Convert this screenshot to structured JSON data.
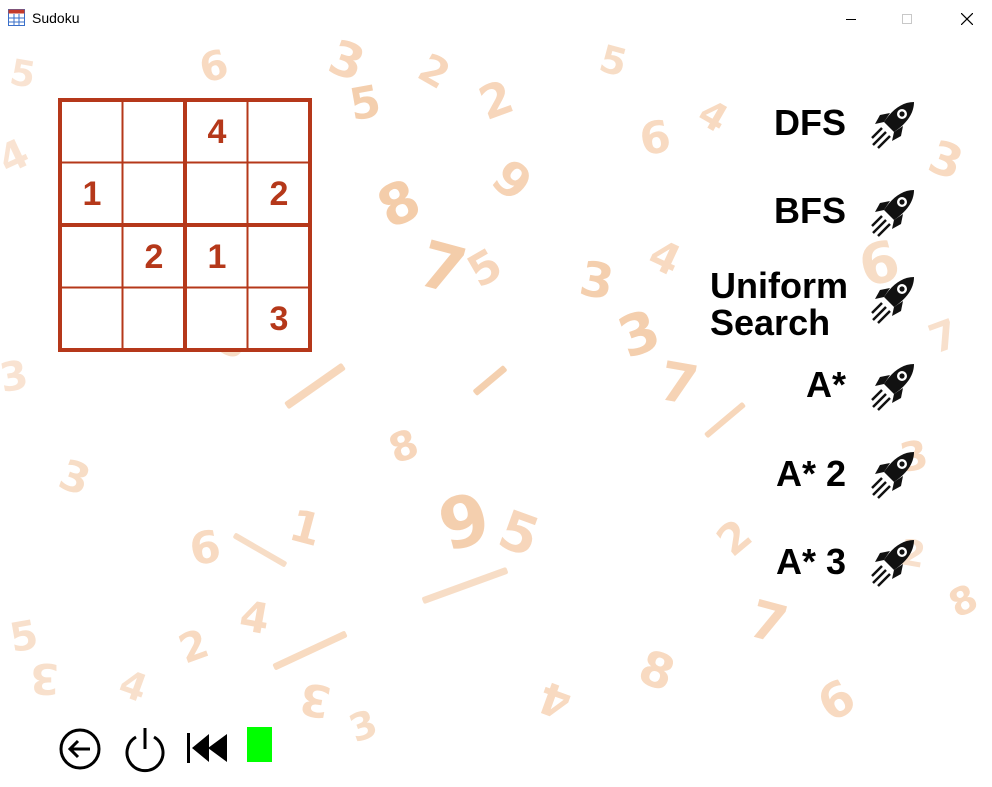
{
  "window": {
    "title": "Sudoku",
    "accent": "#b5381a"
  },
  "board": {
    "size": 4,
    "cells": [
      [
        "",
        "",
        "4",
        ""
      ],
      [
        "1",
        "",
        "",
        "2"
      ],
      [
        "",
        "2",
        "1",
        ""
      ],
      [
        "",
        "",
        "",
        "3"
      ]
    ]
  },
  "algorithms": [
    {
      "label": "DFS",
      "icon": "rocket-icon"
    },
    {
      "label": "BFS",
      "icon": "rocket-icon"
    },
    {
      "label": "Uniform Search",
      "line1": "Uniform",
      "line2": "Search",
      "icon": "rocket-icon"
    },
    {
      "label": "A*",
      "icon": "rocket-icon"
    },
    {
      "label": "A* 2",
      "icon": "rocket-icon"
    },
    {
      "label": "A* 3",
      "icon": "rocket-icon"
    }
  ],
  "controls": {
    "back_icon": "back-arrow-icon",
    "power_icon": "power-icon",
    "rewind_icon": "rewind-icon",
    "status_color": "#00ff00"
  }
}
